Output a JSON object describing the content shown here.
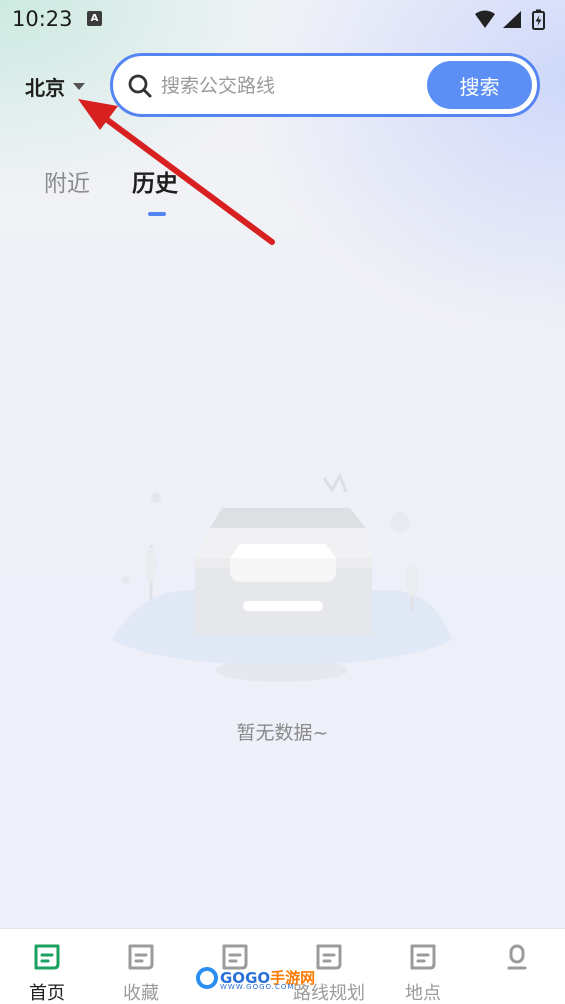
{
  "status_bar": {
    "time": "10:23",
    "notification_icon_letter": "A",
    "icons": [
      "wifi-icon",
      "signal-icon",
      "battery-charging-icon"
    ]
  },
  "header": {
    "city": "北京",
    "search": {
      "placeholder": "搜索公交路线",
      "value": "",
      "button_label": "搜索"
    }
  },
  "tabs": {
    "items": [
      {
        "label": "附近",
        "active": false
      },
      {
        "label": "历史",
        "active": true
      }
    ]
  },
  "empty_state": {
    "message": "暂无数据~"
  },
  "bottom_nav": {
    "items": [
      {
        "label": "首页",
        "icon": "home-icon",
        "active": true
      },
      {
        "label": "收藏",
        "icon": "favorites-icon",
        "active": false
      },
      {
        "label": "",
        "icon": "bus-travel-icon",
        "active": false
      },
      {
        "label": "路线规划",
        "icon": "route-plan-icon",
        "active": false
      },
      {
        "label": "地点",
        "icon": "place-icon",
        "active": false
      },
      {
        "label": "",
        "icon": "profile-icon",
        "active": false
      }
    ]
  },
  "watermark": {
    "brand_part1": "GOGO",
    "brand_part2": "手游网",
    "url": "WWW.GOGO.COM"
  },
  "colors": {
    "accent": "#5585f3",
    "search_button": "#5b8ff5",
    "annotation_arrow": "#e02020",
    "active_nav_icon": "#1aa060"
  }
}
